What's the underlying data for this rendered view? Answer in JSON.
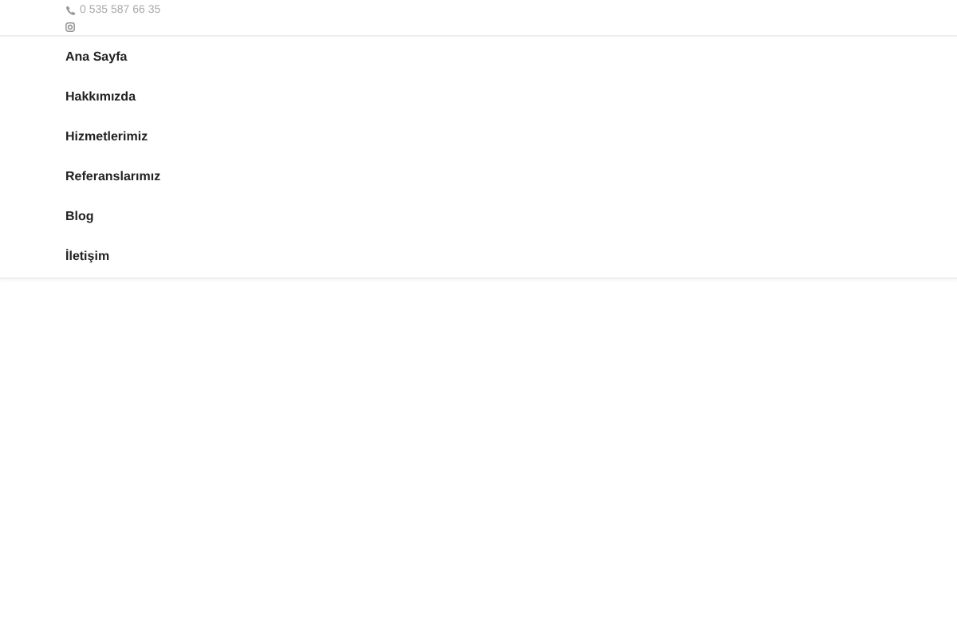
{
  "topbar": {
    "phone": "0 535 587 66 35"
  },
  "menu": [
    {
      "label": "Ana Sayfa"
    },
    {
      "label": "Hakkımızda"
    },
    {
      "label": "Hizmetlerimiz"
    },
    {
      "label": "Referanslarımız"
    },
    {
      "label": "Blog"
    },
    {
      "label": "İletişim"
    }
  ]
}
